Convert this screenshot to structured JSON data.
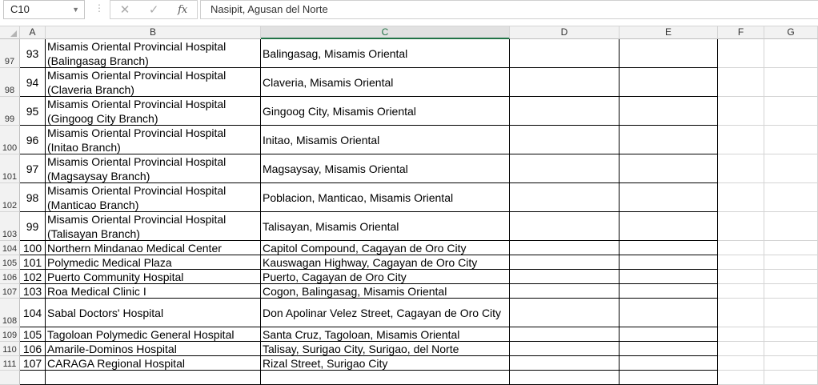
{
  "formula_bar": {
    "name_box": "C10",
    "cancel_icon": "✕",
    "enter_icon": "✓",
    "fx_label": "fx",
    "formula": "Nasipit, Agusan del Norte"
  },
  "columns": [
    "A",
    "B",
    "C",
    "D",
    "E",
    "F",
    "G"
  ],
  "selected_column": "C",
  "rows": [
    {
      "row": "97",
      "no": "93",
      "name": "Misamis Oriental Provincial Hospital\n(Balingasag Branch)",
      "address": "Balingasag, Misamis Oriental"
    },
    {
      "row": "98",
      "no": "94",
      "name": "Misamis Oriental Provincial Hospital\n(Claveria Branch)",
      "address": "Claveria, Misamis Oriental"
    },
    {
      "row": "99",
      "no": "95",
      "name": "Misamis Oriental Provincial Hospital\n(Gingoog City Branch)",
      "address": "Gingoog City, Misamis Oriental"
    },
    {
      "row": "100",
      "no": "96",
      "name": "Misamis Oriental Provincial Hospital\n(Initao Branch)",
      "address": "Initao, Misamis Oriental"
    },
    {
      "row": "101",
      "no": "97",
      "name": "Misamis Oriental Provincial Hospital\n(Magsaysay Branch)",
      "address": "Magsaysay, Misamis Oriental"
    },
    {
      "row": "102",
      "no": "98",
      "name": "Misamis Oriental Provincial Hospital\n(Manticao Branch)",
      "address": "Poblacion, Manticao, Misamis Oriental"
    },
    {
      "row": "103",
      "no": "99",
      "name": "Misamis Oriental Provincial Hospital\n(Talisayan Branch)",
      "address": "Talisayan, Misamis Oriental"
    },
    {
      "row": "104",
      "no": "100",
      "name": "Northern Mindanao Medical Center",
      "address": "Capitol Compound, Cagayan de Oro City"
    },
    {
      "row": "105",
      "no": "101",
      "name": "Polymedic Medical Plaza",
      "address": "Kauswagan Highway, Cagayan de Oro City"
    },
    {
      "row": "106",
      "no": "102",
      "name": "Puerto Community Hospital",
      "address": "Puerto, Cagayan de Oro City"
    },
    {
      "row": "107",
      "no": "103",
      "name": "Roa Medical Clinic I",
      "address": "Cogon, Balingasag, Misamis Oriental"
    },
    {
      "row": "108",
      "no": "104",
      "name": "Sabal Doctors' Hospital",
      "address": "Don Apolinar Velez Street, Cagayan de Oro City",
      "tall": true
    },
    {
      "row": "109",
      "no": "105",
      "name": "Tagoloan Polymedic General Hospital",
      "address": "Santa Cruz, Tagoloan, Misamis Oriental"
    },
    {
      "row": "110",
      "no": "106",
      "name": "Amarile-Dominos Hospital",
      "address": "Talisay, Surigao City, Surigao, del Norte"
    },
    {
      "row": "111",
      "no": "107",
      "name": "CARAGA Regional Hospital",
      "address": "Rizal Street, Surigao City"
    },
    {
      "row": "",
      "no": "",
      "name": "",
      "address": ""
    }
  ]
}
